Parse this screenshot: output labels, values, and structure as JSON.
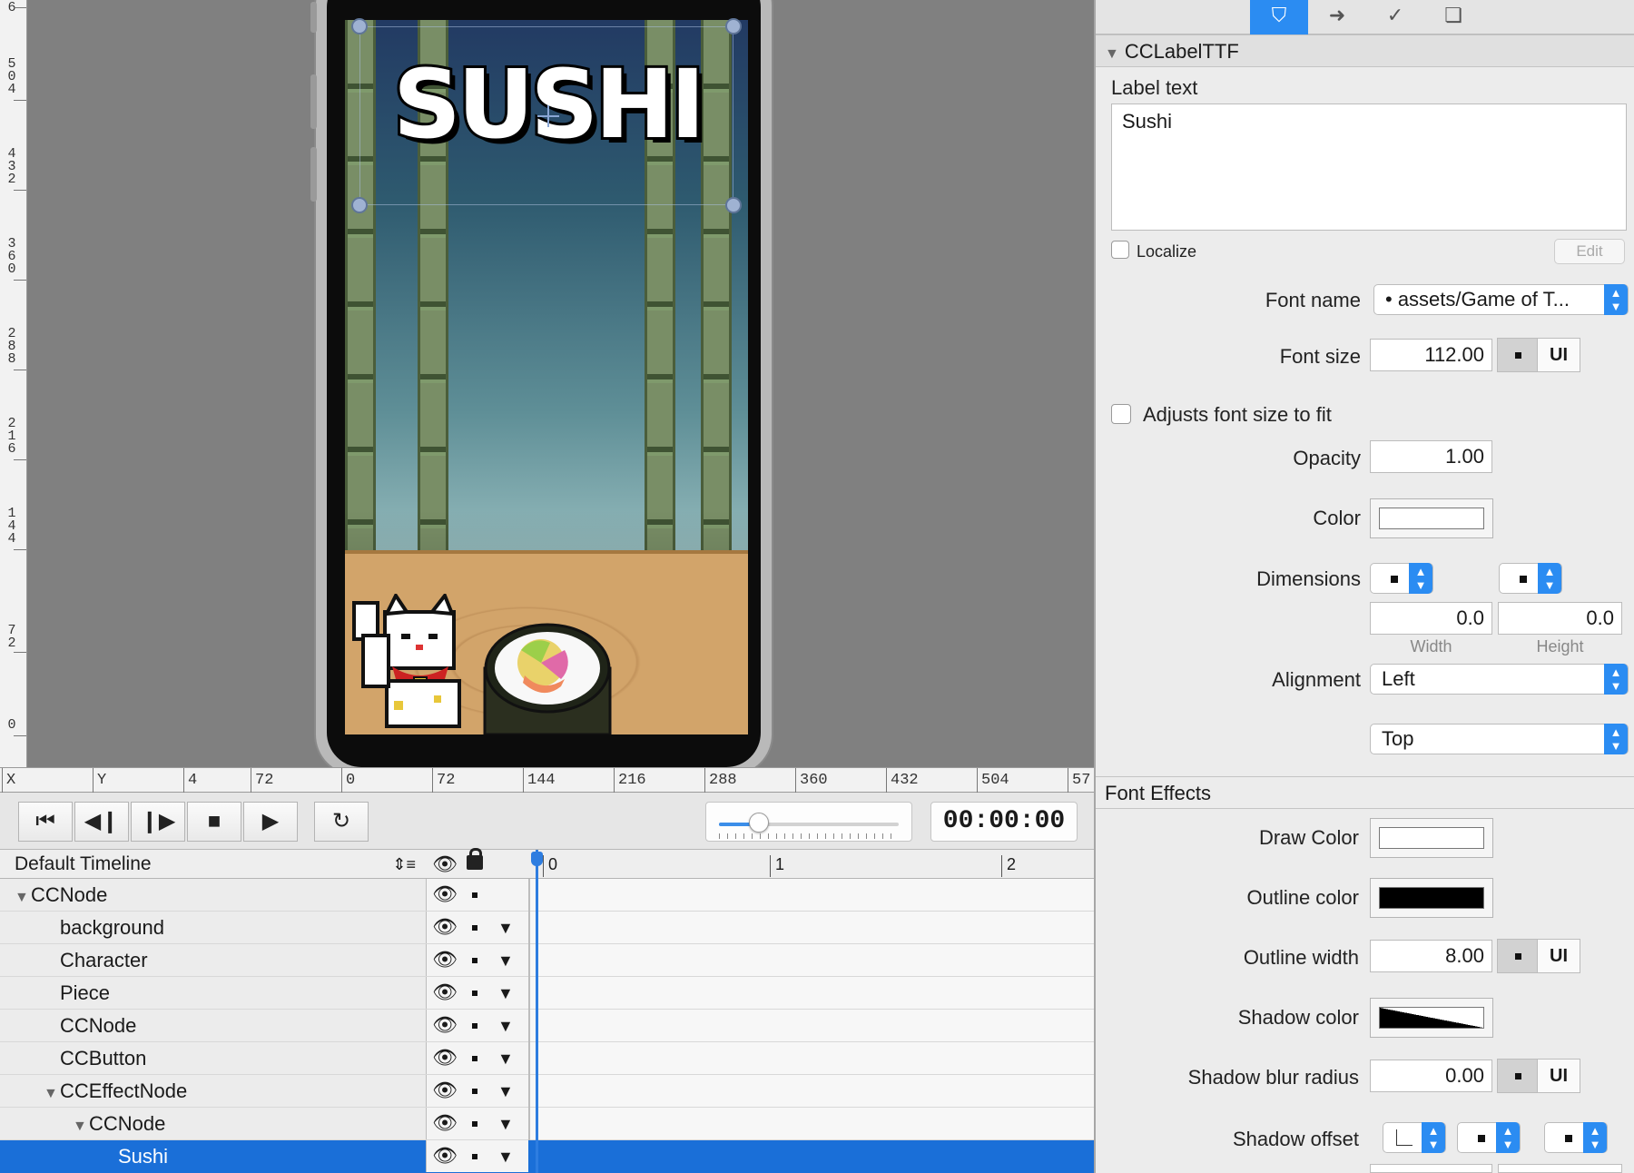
{
  "vruler": {
    "labels": [
      "6",
      "504",
      "432",
      "360",
      "288",
      "216",
      "144",
      "72",
      "0"
    ]
  },
  "hruler": {
    "x_label": "X",
    "y_label": "Y",
    "ticks": [
      "4",
      "72",
      "0",
      "72",
      "144",
      "216",
      "288",
      "360",
      "432",
      "504",
      "57"
    ]
  },
  "scene": {
    "title_text": "SUSHI"
  },
  "transport": {
    "buttons": [
      {
        "id": "jump-start",
        "icon": "skip-to-start-icon",
        "glyph": "⏮"
      },
      {
        "id": "step-back",
        "icon": "step-back-icon",
        "glyph": "◀❙"
      },
      {
        "id": "step-forward",
        "icon": "step-forward-icon",
        "glyph": "❙▶"
      },
      {
        "id": "stop",
        "icon": "stop-icon",
        "glyph": "■"
      },
      {
        "id": "play",
        "icon": "play-icon",
        "glyph": "▶"
      },
      {
        "id": "loop",
        "icon": "loop-icon",
        "glyph": "↻"
      }
    ],
    "zoom_level": 0.22,
    "time": "00:00:00"
  },
  "timeline": {
    "name": "Default Timeline",
    "scale": [
      "0",
      "1",
      "2"
    ],
    "rows": [
      {
        "label": "CCNode",
        "indent": 0,
        "disclosure": "▼",
        "locked_toggle": false,
        "selected": false
      },
      {
        "label": "background",
        "indent": 1,
        "disclosure": "",
        "locked_toggle": true,
        "selected": false
      },
      {
        "label": "Character",
        "indent": 1,
        "disclosure": "",
        "locked_toggle": true,
        "selected": false
      },
      {
        "label": "Piece",
        "indent": 1,
        "disclosure": "",
        "locked_toggle": true,
        "selected": false
      },
      {
        "label": "CCNode",
        "indent": 1,
        "disclosure": "",
        "locked_toggle": true,
        "selected": false
      },
      {
        "label": "CCButton",
        "indent": 1,
        "disclosure": "",
        "locked_toggle": true,
        "selected": false
      },
      {
        "label": "CCEffectNode",
        "indent": 1,
        "disclosure": "▼",
        "locked_toggle": true,
        "selected": false
      },
      {
        "label": "CCNode",
        "indent": 2,
        "disclosure": "▼",
        "locked_toggle": true,
        "selected": false
      },
      {
        "label": "Sushi",
        "indent": 3,
        "disclosure": "",
        "locked_toggle": true,
        "selected": true
      }
    ]
  },
  "inspector": {
    "tabs": [
      {
        "icon": "item-properties-icon",
        "glyph": "⛉",
        "active": true
      },
      {
        "icon": "code-connections-icon",
        "glyph": "➜",
        "active": false
      },
      {
        "icon": "physics-icon",
        "glyph": "✓",
        "active": false
      },
      {
        "icon": "templates-icon",
        "glyph": "❏",
        "active": false
      }
    ],
    "section_title": "CCLabelTTF",
    "label_text_caption": "Label text",
    "label_text_value": "Sushi",
    "localize_label": "Localize",
    "edit_label": "Edit",
    "font_name_label": "Font name",
    "font_name_value": "• assets/Game of T...",
    "font_size_label": "Font size",
    "font_size_value": "112.00",
    "ui_label": "UI",
    "adjusts_label": "Adjusts font size to fit",
    "opacity_label": "Opacity",
    "opacity_value": "1.00",
    "color_label": "Color",
    "dimensions_label": "Dimensions",
    "width_value": "0.0",
    "height_value": "0.0",
    "width_caption": "Width",
    "height_caption": "Height",
    "alignment_label": "Alignment",
    "h_alignment": "Left",
    "v_alignment": "Top",
    "font_effects_title": "Font Effects",
    "draw_color_label": "Draw Color",
    "outline_color_label": "Outline color",
    "outline_width_label": "Outline width",
    "outline_width_value": "8.00",
    "shadow_color_label": "Shadow color",
    "shadow_blur_label": "Shadow blur radius",
    "shadow_blur_value": "0.00",
    "shadow_offset_label": "Shadow offset",
    "colors": {
      "color": "#ffffff",
      "draw_color": "#ffffff",
      "outline_color": "#000000",
      "accent": "#2b8cf2",
      "selection": "#1a6fd8"
    }
  }
}
